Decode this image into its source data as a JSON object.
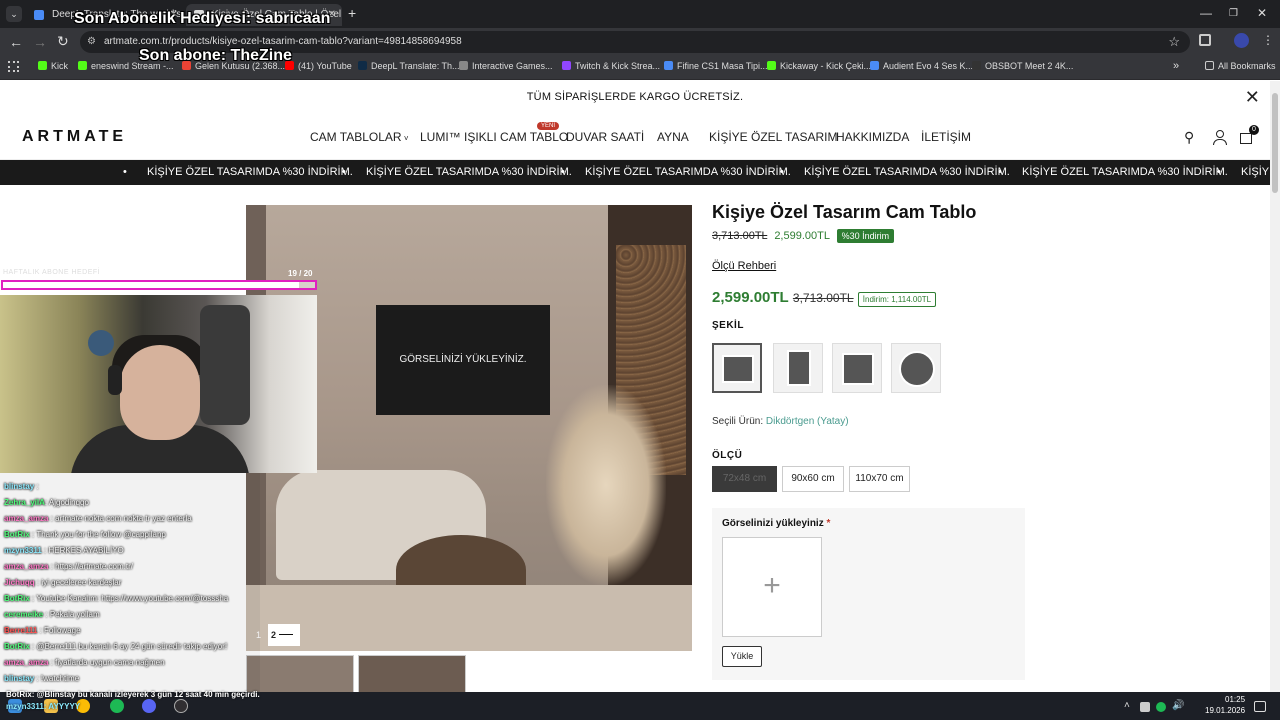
{
  "browser": {
    "tabs": [
      {
        "label": "DeepL Translate: The world's m"
      },
      {
        "label": "Kişiye Özel Cam Tablo | Özel Ta"
      }
    ],
    "new_tab": "+",
    "url": "artmate.com.tr/products/kisiye-ozel-tasarim-cam-tablo?variant=49814858694958",
    "bookmarks": [
      {
        "label": "Kick",
        "color": "#53fc18"
      },
      {
        "label": "eneswind Stream -...",
        "color": "#53fc18"
      },
      {
        "label": "Gelen Kutusu (2.368...",
        "color": "#ea4335"
      },
      {
        "label": "(41) YouTube",
        "color": "#ff0000"
      },
      {
        "label": "DeepL Translate: Th...",
        "color": "#0f2b46"
      },
      {
        "label": "Interactive Games...",
        "color": "#888888"
      },
      {
        "label": "Twitch & Kick Strea...",
        "color": "#9146ff"
      },
      {
        "label": "Fifine CS1 Masa Tipi...",
        "color": "#4a8bf5"
      },
      {
        "label": "Kickaway - Kick Çeki...",
        "color": "#53fc18"
      },
      {
        "label": "Audient Evo 4 Ses K...",
        "color": "#4a8bf5"
      },
      {
        "label": "OBSBOT Meet 2 4K...",
        "color": "#333333"
      }
    ],
    "more_bookmarks": "»",
    "all_bookmarks": "All Bookmarks"
  },
  "overlay": {
    "line1": "Son Abonelik Hediyesi: sabricaan",
    "line2": "Son abone: TheZine",
    "sub_goal_label": "HAFTALIK ABONE HEDEFİ",
    "sub_goal_count": "19 / 20",
    "sub_goal_progress": 0.95
  },
  "site": {
    "promo": "TÜM SİPARİŞLERDE KARGO ÜCRETSİZ.",
    "logo": "ARTMATE",
    "nav": [
      "CAM TABLOLAR",
      "LUMI™ IŞIKLI CAM TABLO",
      "DUVAR SAATİ",
      "AYNA",
      "KİŞİYE ÖZEL TASARIM",
      "HAKKIMIZDA",
      "İLETİŞİM"
    ],
    "nav_badge": "YENİ",
    "cart_count": "0",
    "marquee_text": "KİŞİYE ÖZEL TASARIMDA %30 İNDİRİM.",
    "marquee_tail": "KİŞİYE"
  },
  "product": {
    "canvas_text": "GÖRSELİNİZİ YÜKLEYİNİZ.",
    "slide": "2",
    "slide_prev": "1",
    "title": "Kişiye Özel Tasarım Cam Tablo",
    "old_price": "3,713.00TL",
    "new_price": "2,599.00TL",
    "discount_badge": "%30 İndirim",
    "size_guide": "Ölçü Rehberi",
    "price_big": "2,599.00TL",
    "price_big_old": "3,713.00TL",
    "saving": "İndirim: 1,114.00TL",
    "shape_label": "ŞEKİL",
    "selected_label": "Seçili Ürün:",
    "selected_value": "Dikdörtgen (Yatay)",
    "size_label": "ÖLÇÜ",
    "sizes": [
      "72x48 cm",
      "90x60 cm",
      "110x70 cm"
    ],
    "upload_label": "Görselinizi yükleyiniz",
    "required_mark": "*",
    "upload_button": "Yükle"
  },
  "chat": [
    {
      "user": "blinstay",
      "msg": ":",
      "color": "#8be9fd"
    },
    {
      "user": "Zehra_yilA",
      "msg": ": Ajgodinqqo",
      "color": "#50fa7b"
    },
    {
      "user": "amza_amza",
      "msg": ": artmate nokta com nokta tr yaz enterla",
      "color": "#ff79c6"
    },
    {
      "user": "BotRix",
      "msg": ": Thank you for the follow @cappilanp",
      "color": "#50fa7b"
    },
    {
      "user": "mzyn3311",
      "msg": ": HERKES AYABİLİYO",
      "color": "#8be9fd"
    },
    {
      "user": "amza_amza",
      "msg": ": https://artmate.com.tr/",
      "color": "#ff79c6"
    },
    {
      "user": "Jichuqq",
      "msg": ": iyi geceleree kardeşlar",
      "color": "#ff79c6"
    },
    {
      "user": "BotRix",
      "msg": ": Youtube Kanalım: https://www.youtube.com/@tosssha",
      "color": "#50fa7b"
    },
    {
      "user": "ceremeike",
      "msg": ": Pekala yollam",
      "color": "#50fa7b"
    },
    {
      "user": "Berre111",
      "msg": ": Followage",
      "color": "#ff5555"
    },
    {
      "user": "BotRix",
      "msg": ": @Berre111 bu kanalı 6 ay 24 gün süredir takip ediyor!",
      "color": "#50fa7b"
    },
    {
      "user": "amza_amza",
      "msg": ": fiyatlarda uygun cama nağmen",
      "color": "#ff79c6"
    },
    {
      "user": "blinstay",
      "msg": ": !watchtime",
      "color": "#8be9fd"
    }
  ],
  "last_chat": "BotRix: @Blinstay bu kanalı izleyerek 3 gün 12 saat 40 min geçirdi.",
  "last_chat2": "mzyn3311: AYYYYY",
  "taskbar": {
    "time": "01:25",
    "date": "19.01.2026"
  }
}
